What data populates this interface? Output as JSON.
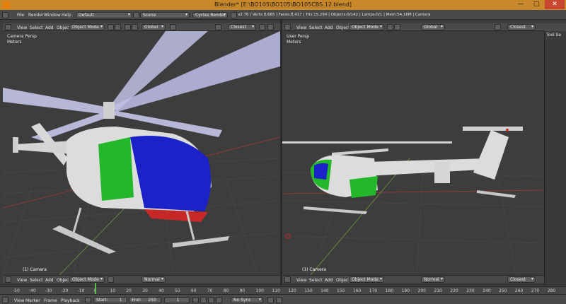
{
  "window": {
    "title": "Blender* [E:\\BO105\\BO105\\BO105CBS.12.blend]",
    "minimize": "—",
    "maximize": "□",
    "close": "✕"
  },
  "info_header": {
    "menus": [
      "File",
      "Render",
      "Window",
      "Help"
    ],
    "layout": "Default",
    "scene": "Scene",
    "engine": "Cycles Render",
    "stats": "v2.76 | Verts:8,665 | Faces:8,417 | Tris:15,294 | Objects:0/142 | Lamps:0/1 | Mem:54.16M | Camera"
  },
  "viewport_left": {
    "view_label": "Camera Persp",
    "units": "Meters",
    "camera_label": "(1) Camera",
    "header_menus": [
      "View",
      "Select",
      "Add",
      "Object"
    ],
    "mode": "Object Mode",
    "pivot": "Global",
    "snap": "Closest"
  },
  "viewport_right": {
    "view_label": "User Persp",
    "units": "Meters",
    "camera_label": "(1) Camera",
    "header_menus": [
      "View",
      "Select",
      "Add",
      "Object"
    ],
    "mode": "Object Mode",
    "pivot": "Global",
    "snap": "Closest"
  },
  "bottom_left": {
    "header_menus": [
      "View",
      "Select",
      "Add",
      "Object"
    ],
    "mode": "Object Mode",
    "shading": "Normal"
  },
  "bottom_right": {
    "header_menus": [
      "View",
      "Select",
      "Add",
      "Object"
    ],
    "mode": "Object Mode",
    "shading": "Normal",
    "snap": "Closest"
  },
  "side_panel": {
    "label": "Tool Se"
  },
  "timeline": {
    "ticks": [
      "-50",
      "-40",
      "-30",
      "-20",
      "-10",
      "0",
      "10",
      "20",
      "30",
      "40",
      "50",
      "60",
      "70",
      "80",
      "90",
      "100",
      "110",
      "120",
      "130",
      "140",
      "150",
      "160",
      "170",
      "180",
      "190",
      "200",
      "210",
      "220",
      "230",
      "240",
      "250",
      "260",
      "270",
      "280"
    ],
    "menus": [
      "View",
      "Marker",
      "Frame",
      "Playback"
    ],
    "start_label": "Start:",
    "start_value": "1",
    "end_label": "End:",
    "end_value": "250",
    "current_frame": "1",
    "sync": "No Sync"
  },
  "colors": {
    "grid": "#4a4a4a",
    "axis_x": "#9c3a3a",
    "axis_y": "#6b9a3a",
    "fuselage": "#dcdcdc",
    "canopy": "#1a22c8",
    "door": "#22b82a",
    "accent": "#e87d0d"
  }
}
